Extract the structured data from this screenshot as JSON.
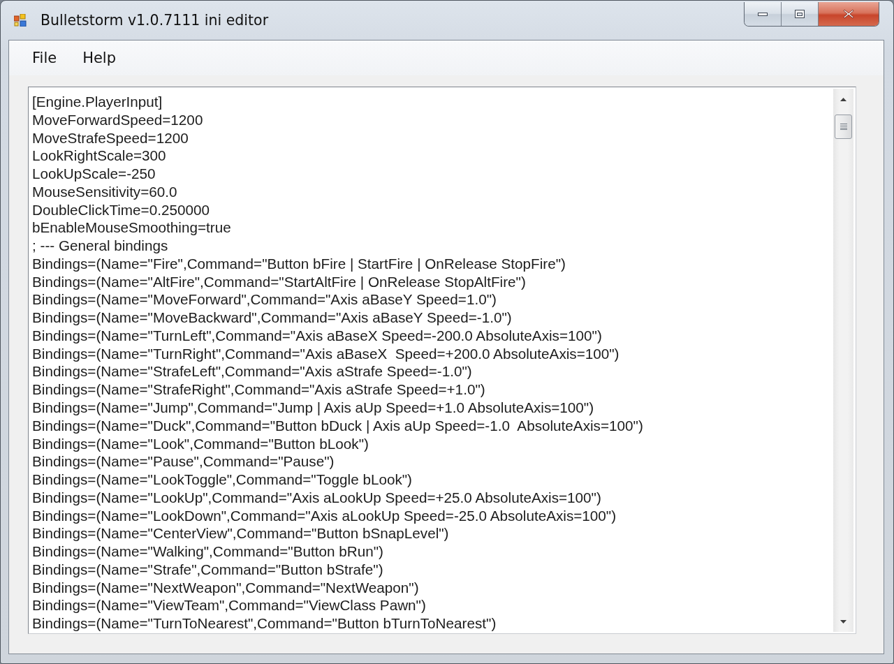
{
  "window": {
    "title": "Bulletstorm v1.0.7111 ini editor"
  },
  "menu_bar": {
    "items": [
      "File",
      "Help"
    ]
  },
  "editor": {
    "lines": [
      "[Engine.PlayerInput]",
      "MoveForwardSpeed=1200",
      "MoveStrafeSpeed=1200",
      "LookRightScale=300",
      "LookUpScale=-250",
      "MouseSensitivity=60.0",
      "DoubleClickTime=0.250000",
      "bEnableMouseSmoothing=true",
      "; --- General bindings",
      "Bindings=(Name=\"Fire\",Command=\"Button bFire | StartFire | OnRelease StopFire\")",
      "Bindings=(Name=\"AltFire\",Command=\"StartAltFire | OnRelease StopAltFire\")",
      "Bindings=(Name=\"MoveForward\",Command=\"Axis aBaseY Speed=1.0\")",
      "Bindings=(Name=\"MoveBackward\",Command=\"Axis aBaseY Speed=-1.0\")",
      "Bindings=(Name=\"TurnLeft\",Command=\"Axis aBaseX Speed=-200.0 AbsoluteAxis=100\")",
      "Bindings=(Name=\"TurnRight\",Command=\"Axis aBaseX  Speed=+200.0 AbsoluteAxis=100\")",
      "Bindings=(Name=\"StrafeLeft\",Command=\"Axis aStrafe Speed=-1.0\")",
      "Bindings=(Name=\"StrafeRight\",Command=\"Axis aStrafe Speed=+1.0\")",
      "Bindings=(Name=\"Jump\",Command=\"Jump | Axis aUp Speed=+1.0 AbsoluteAxis=100\")",
      "Bindings=(Name=\"Duck\",Command=\"Button bDuck | Axis aUp Speed=-1.0  AbsoluteAxis=100\")",
      "Bindings=(Name=\"Look\",Command=\"Button bLook\")",
      "Bindings=(Name=\"Pause\",Command=\"Pause\")",
      "Bindings=(Name=\"LookToggle\",Command=\"Toggle bLook\")",
      "Bindings=(Name=\"LookUp\",Command=\"Axis aLookUp Speed=+25.0 AbsoluteAxis=100\")",
      "Bindings=(Name=\"LookDown\",Command=\"Axis aLookUp Speed=-25.0 AbsoluteAxis=100\")",
      "Bindings=(Name=\"CenterView\",Command=\"Button bSnapLevel\")",
      "Bindings=(Name=\"Walking\",Command=\"Button bRun\")",
      "Bindings=(Name=\"Strafe\",Command=\"Button bStrafe\")",
      "Bindings=(Name=\"NextWeapon\",Command=\"NextWeapon\")",
      "Bindings=(Name=\"ViewTeam\",Command=\"ViewClass Pawn\")",
      "Bindings=(Name=\"TurnToNearest\",Command=\"Button bTurnToNearest\")"
    ]
  }
}
